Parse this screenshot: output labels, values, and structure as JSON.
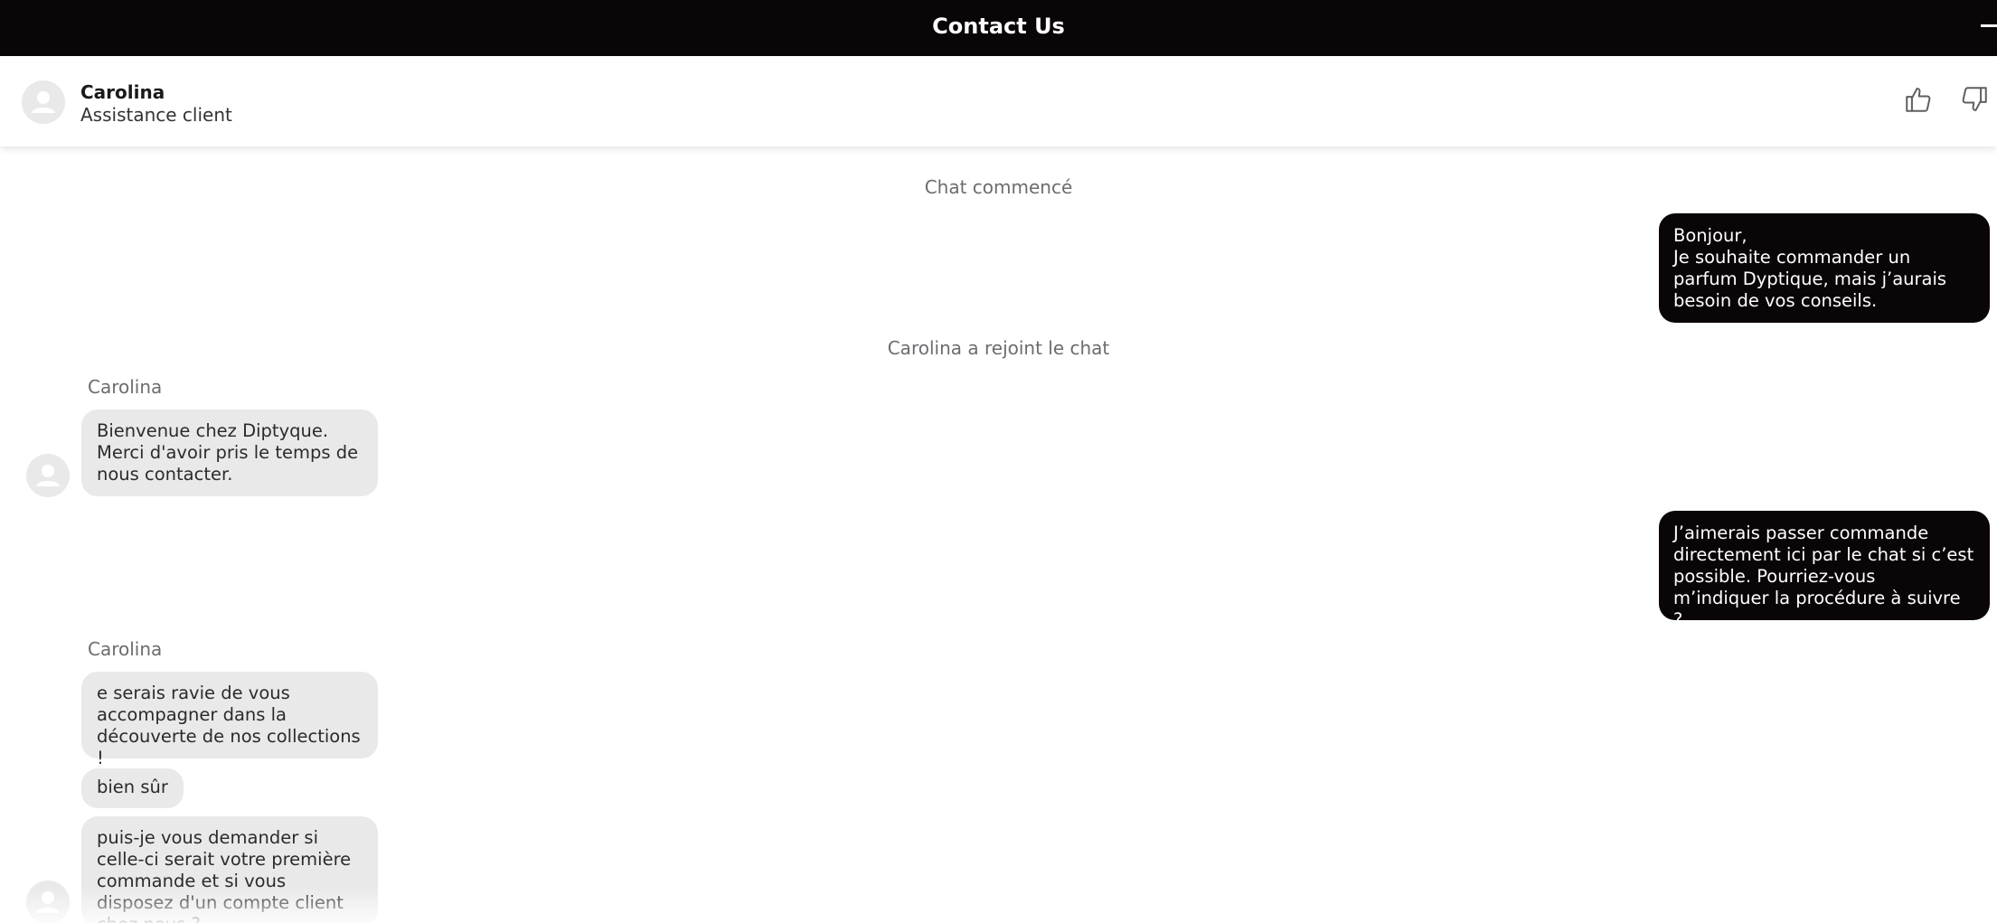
{
  "header": {
    "title": "Contact Us",
    "minimize_icon": "minus-icon"
  },
  "agent": {
    "name": "Carolina",
    "role": "Assistance client",
    "avatar_icon": "user-avatar-icon",
    "feedback": {
      "like_icon": "thumbs-up-icon",
      "dislike_icon": "thumbs-down-icon"
    }
  },
  "chat": {
    "event_started": "Chat commencé",
    "event_joined": "Carolina a rejoint le chat",
    "messages": [
      {
        "from": "user",
        "text": "Bonjour,\nJe souhaite commander un parfum Dyptique, mais j’aurais besoin de vos conseils."
      },
      {
        "from": "agent",
        "sender": "Carolina",
        "text": "Bienvenue chez Diptyque.\nMerci d'avoir pris le temps de nous contacter."
      },
      {
        "from": "user",
        "text": "J’aimerais passer commande directement ici par le chat si c’est possible. Pourriez-vous m’indiquer la procédure à suivre ?"
      },
      {
        "from": "agent",
        "sender": "Carolina",
        "text": "e serais ravie de vous accompagner dans la découverte de nos collections !"
      },
      {
        "from": "agent",
        "text": "bien sûr"
      },
      {
        "from": "agent",
        "text": "puis-je vous demander si celle-ci serait votre première commande et si vous disposez d'un compte client chez nous ?"
      }
    ]
  },
  "colors": {
    "header_bg": "#0a0506",
    "user_bubble": "#0a0506",
    "agent_bubble": "#e9e9ea",
    "event_text": "#6c6c70"
  }
}
